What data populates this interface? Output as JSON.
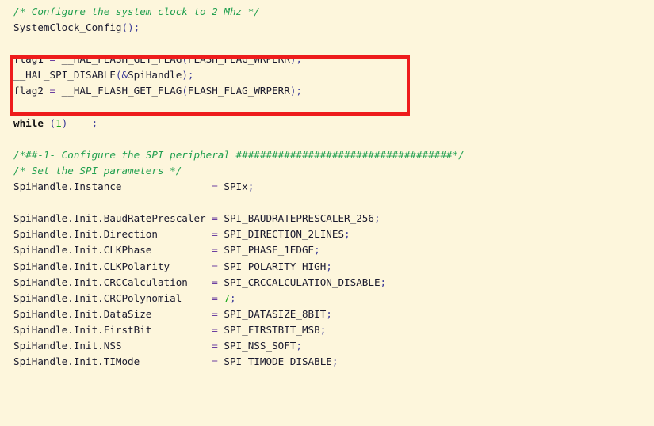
{
  "editor": {
    "background_color": "#fdf6dc",
    "comment_color": "#22a050",
    "identifier_color": "#1a1a2e",
    "operator_color": "#6b3fa0",
    "punctuation_color": "#3b3b98",
    "keyword_color": "#101010",
    "number_color": "#17a81a",
    "highlight_box_color": "#ee1c1c"
  },
  "code": {
    "lines": [
      {
        "id": "line-1",
        "text": "/* Configure the system clock to 2 Mhz */"
      },
      {
        "id": "line-2",
        "text": "SystemClock_Config();"
      },
      {
        "id": "line-3",
        "text": ""
      },
      {
        "id": "line-4",
        "text": "flag1 = __HAL_FLASH_GET_FLAG(FLASH_FLAG_WRPERR);"
      },
      {
        "id": "line-5",
        "text": "__HAL_SPI_DISABLE(&SpiHandle);"
      },
      {
        "id": "line-6",
        "text": "flag2 = __HAL_FLASH_GET_FLAG(FLASH_FLAG_WRPERR);"
      },
      {
        "id": "line-7",
        "text": ""
      },
      {
        "id": "line-8",
        "text": "while (1)    ;"
      },
      {
        "id": "line-9",
        "text": ""
      },
      {
        "id": "line-10",
        "text": "/*##-1- Configure the SPI peripheral ####################################*/"
      },
      {
        "id": "line-11",
        "text": "/* Set the SPI parameters */"
      },
      {
        "id": "line-12",
        "text": "SpiHandle.Instance               = SPIx;"
      },
      {
        "id": "line-13",
        "text": ""
      },
      {
        "id": "line-14",
        "text": "SpiHandle.Init.BaudRatePrescaler = SPI_BAUDRATEPRESCALER_256;"
      },
      {
        "id": "line-15",
        "text": "SpiHandle.Init.Direction         = SPI_DIRECTION_2LINES;"
      },
      {
        "id": "line-16",
        "text": "SpiHandle.Init.CLKPhase          = SPI_PHASE_1EDGE;"
      },
      {
        "id": "line-17",
        "text": "SpiHandle.Init.CLKPolarity       = SPI_POLARITY_HIGH;"
      },
      {
        "id": "line-18",
        "text": "SpiHandle.Init.CRCCalculation    = SPI_CRCCALCULATION_DISABLE;"
      },
      {
        "id": "line-19",
        "text": "SpiHandle.Init.CRCPolynomial     = 7;"
      },
      {
        "id": "line-20",
        "text": "SpiHandle.Init.DataSize          = SPI_DATASIZE_8BIT;"
      },
      {
        "id": "line-21",
        "text": "SpiHandle.Init.FirstBit          = SPI_FIRSTBIT_MSB;"
      },
      {
        "id": "line-22",
        "text": "SpiHandle.Init.NSS               = SPI_NSS_SOFT;"
      },
      {
        "id": "line-23",
        "text": "SpiHandle.Init.TIMode            = SPI_TIMODE_DISABLE;"
      }
    ],
    "tokens": [
      [
        {
          "t": "/* Configure the system clock to 2 Mhz */",
          "c": "cmt"
        }
      ],
      [
        {
          "t": "SystemClock_Config",
          "c": "ident"
        },
        {
          "t": "()",
          "c": "punc"
        },
        {
          "t": ";",
          "c": "punc"
        }
      ],
      [
        {
          "t": "",
          "c": "plain"
        }
      ],
      [
        {
          "t": "flag1 ",
          "c": "ident"
        },
        {
          "t": "= ",
          "c": "op"
        },
        {
          "t": "__HAL_FLASH_GET_FLAG",
          "c": "ident"
        },
        {
          "t": "(",
          "c": "punc"
        },
        {
          "t": "FLASH_FLAG_WRPERR",
          "c": "ident"
        },
        {
          "t": ");",
          "c": "punc"
        }
      ],
      [
        {
          "t": "__HAL_SPI_DISABLE",
          "c": "ident"
        },
        {
          "t": "(&",
          "c": "punc"
        },
        {
          "t": "SpiHandle",
          "c": "ident"
        },
        {
          "t": ");",
          "c": "punc"
        }
      ],
      [
        {
          "t": "flag2 ",
          "c": "ident"
        },
        {
          "t": "= ",
          "c": "op"
        },
        {
          "t": "__HAL_FLASH_GET_FLAG",
          "c": "ident"
        },
        {
          "t": "(",
          "c": "punc"
        },
        {
          "t": "FLASH_FLAG_WRPERR",
          "c": "ident"
        },
        {
          "t": ");",
          "c": "punc"
        }
      ],
      [
        {
          "t": "",
          "c": "plain"
        }
      ],
      [
        {
          "t": "while ",
          "c": "kw"
        },
        {
          "t": "(",
          "c": "punc"
        },
        {
          "t": "1",
          "c": "num"
        },
        {
          "t": ")",
          "c": "punc"
        },
        {
          "t": "    ",
          "c": "plain"
        },
        {
          "t": ";",
          "c": "punc"
        }
      ],
      [
        {
          "t": "",
          "c": "plain"
        }
      ],
      [
        {
          "t": "/*##-1- Configure the SPI peripheral ####################################*/",
          "c": "cmt"
        }
      ],
      [
        {
          "t": "/* Set the SPI parameters */",
          "c": "cmt"
        }
      ],
      [
        {
          "t": "SpiHandle.Instance               ",
          "c": "ident"
        },
        {
          "t": "= ",
          "c": "op"
        },
        {
          "t": "SPIx",
          "c": "ident"
        },
        {
          "t": ";",
          "c": "punc"
        }
      ],
      [
        {
          "t": "",
          "c": "plain"
        }
      ],
      [
        {
          "t": "SpiHandle.Init.BaudRatePrescaler ",
          "c": "ident"
        },
        {
          "t": "= ",
          "c": "op"
        },
        {
          "t": "SPI_BAUDRATEPRESCALER_256",
          "c": "ident"
        },
        {
          "t": ";",
          "c": "punc"
        }
      ],
      [
        {
          "t": "SpiHandle.Init.Direction         ",
          "c": "ident"
        },
        {
          "t": "= ",
          "c": "op"
        },
        {
          "t": "SPI_DIRECTION_2LINES",
          "c": "ident"
        },
        {
          "t": ";",
          "c": "punc"
        }
      ],
      [
        {
          "t": "SpiHandle.Init.CLKPhase          ",
          "c": "ident"
        },
        {
          "t": "= ",
          "c": "op"
        },
        {
          "t": "SPI_PHASE_1EDGE",
          "c": "ident"
        },
        {
          "t": ";",
          "c": "punc"
        }
      ],
      [
        {
          "t": "SpiHandle.Init.CLKPolarity       ",
          "c": "ident"
        },
        {
          "t": "= ",
          "c": "op"
        },
        {
          "t": "SPI_POLARITY_HIGH",
          "c": "ident"
        },
        {
          "t": ";",
          "c": "punc"
        }
      ],
      [
        {
          "t": "SpiHandle.Init.CRCCalculation    ",
          "c": "ident"
        },
        {
          "t": "= ",
          "c": "op"
        },
        {
          "t": "SPI_CRCCALCULATION_DISABLE",
          "c": "ident"
        },
        {
          "t": ";",
          "c": "punc"
        }
      ],
      [
        {
          "t": "SpiHandle.Init.CRCPolynomial     ",
          "c": "ident"
        },
        {
          "t": "= ",
          "c": "op"
        },
        {
          "t": "7",
          "c": "num"
        },
        {
          "t": ";",
          "c": "punc"
        }
      ],
      [
        {
          "t": "SpiHandle.Init.DataSize          ",
          "c": "ident"
        },
        {
          "t": "= ",
          "c": "op"
        },
        {
          "t": "SPI_DATASIZE_8BIT",
          "c": "ident"
        },
        {
          "t": ";",
          "c": "punc"
        }
      ],
      [
        {
          "t": "SpiHandle.Init.FirstBit          ",
          "c": "ident"
        },
        {
          "t": "= ",
          "c": "op"
        },
        {
          "t": "SPI_FIRSTBIT_MSB",
          "c": "ident"
        },
        {
          "t": ";",
          "c": "punc"
        }
      ],
      [
        {
          "t": "SpiHandle.Init.NSS               ",
          "c": "ident"
        },
        {
          "t": "= ",
          "c": "op"
        },
        {
          "t": "SPI_NSS_SOFT",
          "c": "ident"
        },
        {
          "t": ";",
          "c": "punc"
        }
      ],
      [
        {
          "t": "SpiHandle.Init.TIMode            ",
          "c": "ident"
        },
        {
          "t": "= ",
          "c": "op"
        },
        {
          "t": "SPI_TIMODE_DISABLE",
          "c": "ident"
        },
        {
          "t": ";",
          "c": "punc"
        }
      ]
    ]
  },
  "annotation": {
    "highlight_box": {
      "label": "highlight-rectangle",
      "covers_lines": [
        4,
        5,
        6
      ]
    }
  }
}
